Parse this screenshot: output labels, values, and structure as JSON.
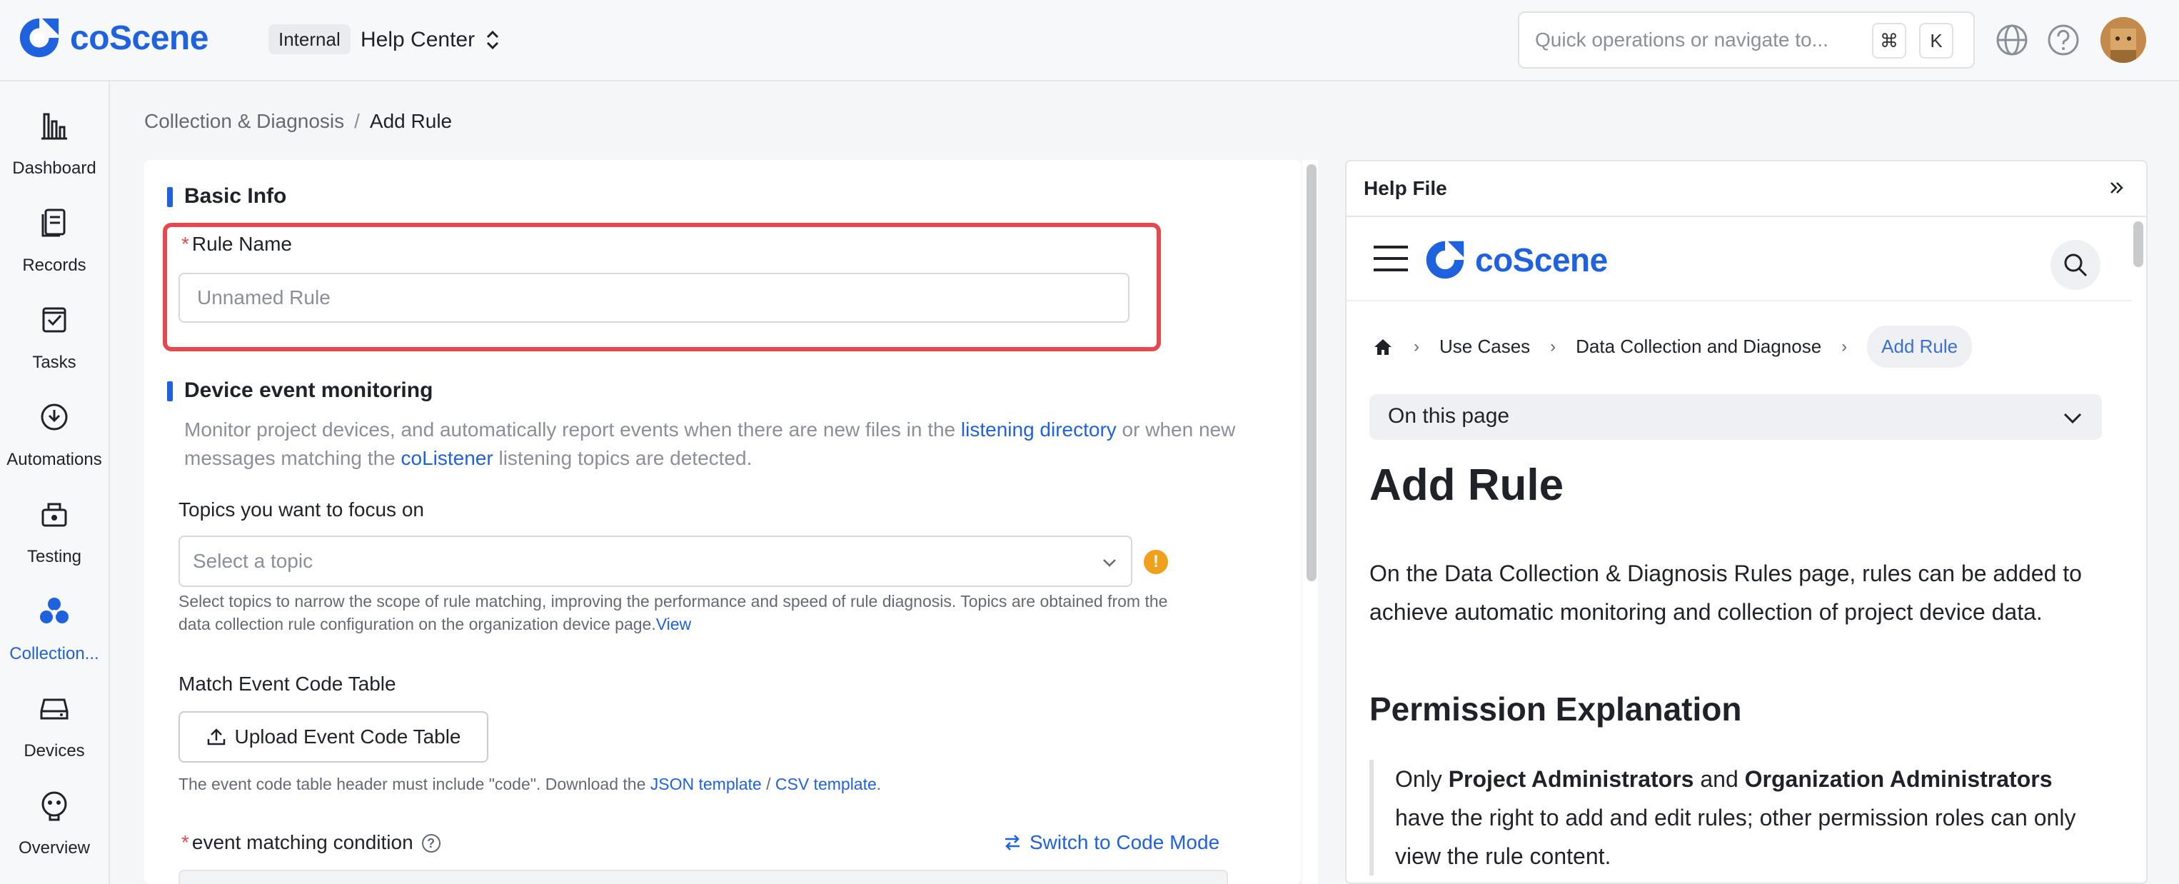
{
  "header": {
    "brand": "coScene",
    "project_tag": "Internal",
    "project_name": "Help Center",
    "search_placeholder": "Quick operations or navigate to...",
    "shortcut_mod": "⌘",
    "shortcut_key": "K"
  },
  "sidebar": {
    "items": [
      {
        "label": "Dashboard",
        "icon": "bar-chart-icon"
      },
      {
        "label": "Records",
        "icon": "records-icon"
      },
      {
        "label": "Tasks",
        "icon": "tasks-icon"
      },
      {
        "label": "Automations",
        "icon": "automations-icon"
      },
      {
        "label": "Testing",
        "icon": "testing-icon"
      },
      {
        "label": "Collection...",
        "icon": "collection-icon",
        "active": true
      },
      {
        "label": "Devices",
        "icon": "devices-icon"
      },
      {
        "label": "Overview",
        "icon": "overview-icon"
      }
    ]
  },
  "breadcrumb": {
    "parent": "Collection & Diagnosis",
    "separator": "/",
    "current": "Add Rule"
  },
  "form": {
    "basic_info_title": "Basic Info",
    "rule_name_label": "Rule Name",
    "rule_name_placeholder": "Unnamed Rule",
    "device_monitoring_title": "Device event monitoring",
    "monitor_desc_1": "Monitor project devices, and automatically report events when there are new files in the ",
    "monitor_link_1": "listening directory",
    "monitor_desc_2": " or when new messages matching the ",
    "monitor_link_2": "coListener",
    "monitor_desc_3": " listening topics are detected.",
    "topics_label": "Topics you want to focus on",
    "topic_placeholder": "Select a topic",
    "warn_mark": "!",
    "topic_hint": "Select topics to narrow the scope of rule matching, improving the performance and speed of rule diagnosis. Topics are obtained from the data collection rule configuration on the organization device page.",
    "topic_hint_link": "View",
    "event_code_label": "Match Event Code Table",
    "upload_button": "Upload Event Code Table",
    "code_hint_1": "The event code table header must include \"code\". Download the ",
    "code_hint_json": "JSON template",
    "code_hint_sep": " / ",
    "code_hint_csv": "CSV template",
    "code_hint_end": ".",
    "condition_label": "event matching condition",
    "condition_help": "?",
    "switch_mode": "Switch to Code Mode",
    "required_mark": "*"
  },
  "help": {
    "title": "Help File",
    "doc_brand": "coScene",
    "crumbs": [
      "Use Cases",
      "Data Collection and Diagnose",
      "Add Rule"
    ],
    "chevron": "›",
    "on_this_page": "On this page",
    "h1": "Add Rule",
    "intro": "On the Data Collection & Diagnosis Rules page, rules can be added to achieve automatic monitoring and collection of project device data.",
    "h2": "Permission Explanation",
    "quote_1": "Only ",
    "quote_b1": "Project Administrators",
    "quote_2": " and ",
    "quote_b2": "Organization Administrators",
    "quote_3": " have the right to add and edit rules; other permission roles can only view the rule content."
  },
  "colors": {
    "accent": "#1f62e0",
    "highlight": "#e5484d",
    "warning": "#f0a01a"
  }
}
